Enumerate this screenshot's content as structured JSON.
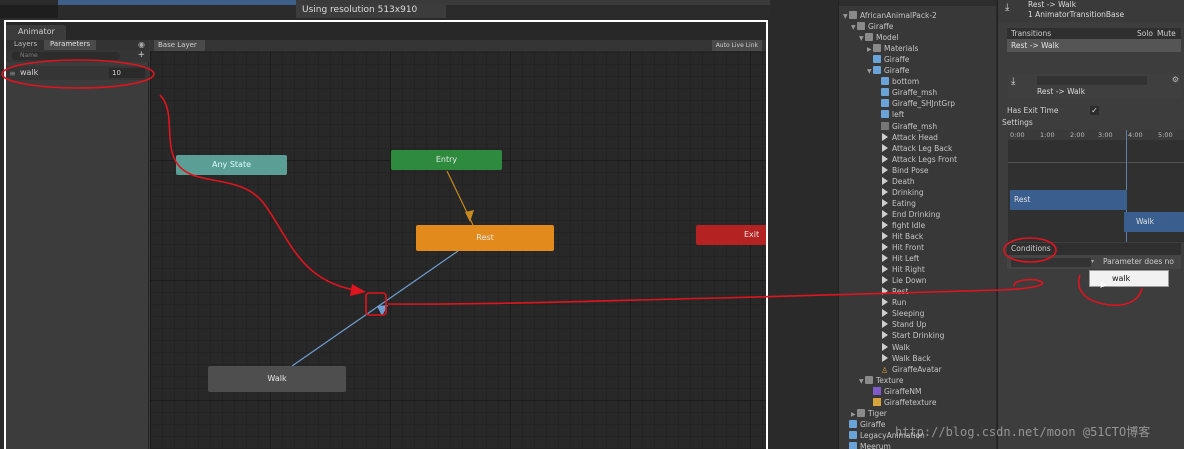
{
  "top": {
    "resolution": "Using resolution 513x910"
  },
  "animator": {
    "tab": "Animator",
    "tabs": {
      "layers": "Layers",
      "parameters": "Parameters"
    },
    "search_placeholder": "Name",
    "param": {
      "name": "walk",
      "value": "10"
    },
    "breadcrumb": "Base Layer",
    "auto_live_link": "Auto Live Link",
    "nodes": {
      "any_state": "Any State",
      "entry": "Entry",
      "rest": "Rest",
      "walk": "Walk",
      "exit": "Exit"
    }
  },
  "hierarchy": {
    "items": [
      {
        "label": "AfricanAnimalPack-2",
        "indent": 0,
        "icon": "folder",
        "arrow": "▼"
      },
      {
        "label": "Giraffe",
        "indent": 1,
        "icon": "folder",
        "arrow": "▼"
      },
      {
        "label": "Model",
        "indent": 2,
        "icon": "folder",
        "arrow": "▼"
      },
      {
        "label": "Materials",
        "indent": 3,
        "icon": "folder",
        "arrow": "▶"
      },
      {
        "label": "Giraffe",
        "indent": 3,
        "icon": "mesh",
        "arrow": ""
      },
      {
        "label": "Giraffe",
        "indent": 3,
        "icon": "mesh",
        "arrow": "▼"
      },
      {
        "label": "bottom",
        "indent": 4,
        "icon": "mesh",
        "arrow": ""
      },
      {
        "label": "Giraffe_msh",
        "indent": 4,
        "icon": "mesh",
        "arrow": ""
      },
      {
        "label": "Giraffe_SHJntGrp",
        "indent": 4,
        "icon": "mesh",
        "arrow": ""
      },
      {
        "label": "left",
        "indent": 4,
        "icon": "mesh",
        "arrow": ""
      },
      {
        "label": "Giraffe_msh",
        "indent": 4,
        "icon": "grey",
        "arrow": ""
      },
      {
        "label": "Attack Head",
        "indent": 4,
        "icon": "clip",
        "arrow": ""
      },
      {
        "label": "Attack Leg Back",
        "indent": 4,
        "icon": "clip",
        "arrow": ""
      },
      {
        "label": "Attack Legs Front",
        "indent": 4,
        "icon": "clip",
        "arrow": ""
      },
      {
        "label": "Bind Pose",
        "indent": 4,
        "icon": "clip",
        "arrow": ""
      },
      {
        "label": "Death",
        "indent": 4,
        "icon": "clip",
        "arrow": ""
      },
      {
        "label": "Drinking",
        "indent": 4,
        "icon": "clip",
        "arrow": ""
      },
      {
        "label": "Eating",
        "indent": 4,
        "icon": "clip",
        "arrow": ""
      },
      {
        "label": "End Drinking",
        "indent": 4,
        "icon": "clip",
        "arrow": ""
      },
      {
        "label": "fight Idle",
        "indent": 4,
        "icon": "clip",
        "arrow": ""
      },
      {
        "label": "Hit Back",
        "indent": 4,
        "icon": "clip",
        "arrow": ""
      },
      {
        "label": "Hit Front",
        "indent": 4,
        "icon": "clip",
        "arrow": ""
      },
      {
        "label": "Hit Left",
        "indent": 4,
        "icon": "clip",
        "arrow": ""
      },
      {
        "label": "Hit Right",
        "indent": 4,
        "icon": "clip",
        "arrow": ""
      },
      {
        "label": "Lie Down",
        "indent": 4,
        "icon": "clip",
        "arrow": ""
      },
      {
        "label": "Rest",
        "indent": 4,
        "icon": "clip",
        "arrow": ""
      },
      {
        "label": "Run",
        "indent": 4,
        "icon": "clip",
        "arrow": ""
      },
      {
        "label": "Sleeping",
        "indent": 4,
        "icon": "clip",
        "arrow": ""
      },
      {
        "label": "Stand Up",
        "indent": 4,
        "icon": "clip",
        "arrow": ""
      },
      {
        "label": "Start Drinking",
        "indent": 4,
        "icon": "clip",
        "arrow": ""
      },
      {
        "label": "Walk",
        "indent": 4,
        "icon": "clip",
        "arrow": ""
      },
      {
        "label": "Walk Back",
        "indent": 4,
        "icon": "clip",
        "arrow": ""
      },
      {
        "label": "GiraffeAvatar",
        "indent": 4,
        "icon": "avatar",
        "arrow": ""
      },
      {
        "label": "Texture",
        "indent": 2,
        "icon": "folder",
        "arrow": "▼"
      },
      {
        "label": "GiraffeNM",
        "indent": 3,
        "icon": "mat",
        "arrow": ""
      },
      {
        "label": "Giraffetexture",
        "indent": 3,
        "icon": "tex",
        "arrow": ""
      },
      {
        "label": "Tiger",
        "indent": 1,
        "icon": "folder",
        "arrow": "▶"
      },
      {
        "label": "Giraffe",
        "indent": 0,
        "icon": "mesh",
        "arrow": ""
      },
      {
        "label": "LegacyAnimation",
        "indent": 0,
        "icon": "mesh",
        "arrow": ""
      },
      {
        "label": "Meerum",
        "indent": 0,
        "icon": "mesh",
        "arrow": ""
      }
    ]
  },
  "inspector": {
    "title": "Rest -> Walk",
    "subtitle": "1 AnimatorTransitionBase",
    "transitions_header": "Transitions",
    "solo": "Solo",
    "mute": "Mute",
    "transition_row": "Rest -> Walk",
    "sub_title": "Rest -> Walk",
    "has_exit_time": "Has Exit Time",
    "settings": "Settings",
    "ticks": [
      "0:00",
      "1:00",
      "2:00",
      "3:00",
      "4:00",
      "5:00"
    ],
    "bar_rest": "Rest",
    "bar_walk": "Walk",
    "conditions": "Conditions",
    "condition_msg": "Parameter does no",
    "popup_item": "walk"
  },
  "watermark": "http://blog.csdn.net/moon @51CTO博客"
}
